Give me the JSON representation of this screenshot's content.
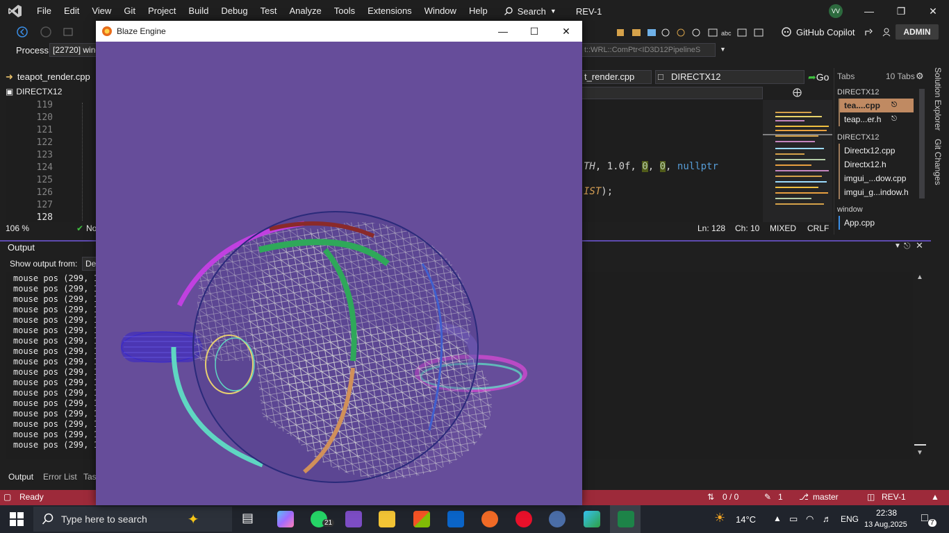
{
  "menubar": {
    "items": [
      "File",
      "Edit",
      "View",
      "Git",
      "Project",
      "Build",
      "Debug",
      "Test",
      "Analyze",
      "Tools",
      "Extensions",
      "Window",
      "Help"
    ],
    "search_label": "Search",
    "solution_name": "REV-1",
    "avatar_initials": "VV"
  },
  "toolbar": {
    "copilot_label": "GitHub Copilot",
    "admin_label": "ADMIN"
  },
  "process": {
    "label": "Process:",
    "value": "[22720] wind",
    "stack_frame": "t::WRL::ComPtr<ID3D12PipelineS"
  },
  "editor": {
    "tab_left": "teapot_render.cpp",
    "project_combo": "DIRECTX12",
    "file_combo": "t_render.cpp",
    "scope_combo": "DIRECTX12",
    "go_label": "Go",
    "line_numbers": [
      "119",
      "120",
      "121",
      "122",
      "123",
      "124",
      "125",
      "126",
      "127",
      "128"
    ],
    "code_line_a_const": "TH",
    "code_line_a_rest": ", 1.0f, ",
    "code_line_a_hl1": "0",
    "code_line_a_sep": ", ",
    "code_line_a_hl2": "0",
    "code_line_a_tail": ", ",
    "code_line_a_kw": "nullptr",
    "code_line_b_const": "IST",
    "code_line_b_rest": ");",
    "zoom": "106 %",
    "issues": "No",
    "cursor_line": "Ln: 128",
    "cursor_col": "Ch: 10",
    "indent": "MIXED",
    "line_ending": "CRLF"
  },
  "tabs_panel": {
    "title": "Tabs",
    "count": "10 Tabs",
    "groups": [
      {
        "name": "DIRECTX12",
        "items": [
          "tea....cpp",
          "teap...er.h"
        ]
      },
      {
        "name": "DIRECTX12",
        "items": [
          "Directx12.cpp",
          "Directx12.h",
          "imgui_...dow.cpp",
          "imgui_g...indow.h"
        ]
      },
      {
        "name": "window",
        "items": [
          "App.cpp"
        ]
      }
    ]
  },
  "side_tabs": [
    "Solution Explorer",
    "Git Changes"
  ],
  "output": {
    "title": "Output",
    "show_from_label": "Show output from:",
    "show_from_value": "De",
    "lines": [
      "mouse pos (299, 1",
      "mouse pos (299, 1",
      "mouse pos (299, 1",
      "mouse pos (299, 1",
      "mouse pos (299, 1",
      "mouse pos (299, 1",
      "mouse pos (299, 1",
      "mouse pos (299, 1",
      "mouse pos (299, 1",
      "mouse pos (299, 1",
      "mouse pos (299, 1",
      "mouse pos (299, 1",
      "mouse pos (299, 1",
      "mouse pos (299, 1",
      "mouse pos (299, 1",
      "mouse pos (299, 1",
      "mouse pos (299, 1"
    ],
    "tabs": [
      "Output",
      "Error List",
      "Tas"
    ]
  },
  "statusbar": {
    "state": "Ready",
    "sync": "0 / 0",
    "changes": "1",
    "branch": "master",
    "repo": "REV-1"
  },
  "taskbar": {
    "search_placeholder": "Type here to search",
    "whatsapp_badge": "21",
    "weather": "14°C",
    "language": "ENG",
    "time": "22:38",
    "date": "13 Aug,2025",
    "notifications": "7"
  },
  "engine_window": {
    "title": "Blaze Engine",
    "background": "#664d9a"
  },
  "colors": {
    "statusbar": "#9d2a3a",
    "accent": "#5e4bb0",
    "tab_active": "#c08a62"
  }
}
